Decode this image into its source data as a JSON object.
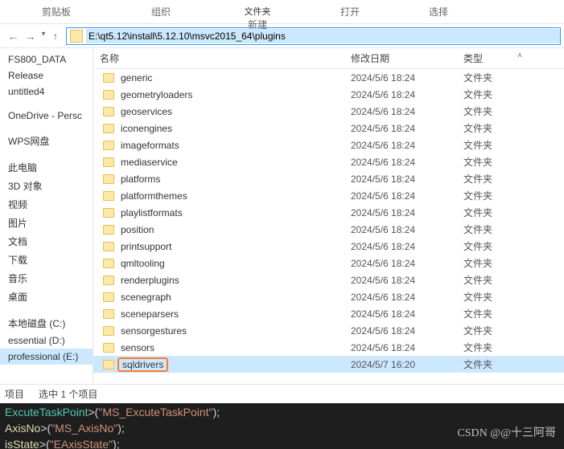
{
  "ribbon": {
    "clip_label": "剪贴板",
    "org_label": "组织",
    "file_top": "文件夹",
    "new_label": "新建",
    "open_label": "打开",
    "select_label": "选择"
  },
  "address": {
    "path": "E:\\qt5.12\\install\\5.12.10\\msvc2015_64\\plugins"
  },
  "tree": {
    "items": [
      "FS800_DATA",
      "Release",
      "untitled4",
      "OneDrive - Persc",
      "WPS网盘",
      "此电脑",
      "3D 对象",
      "视频",
      "图片",
      "文档",
      "下载",
      "音乐",
      "桌面",
      "本地磁盘 (C:)",
      "essential (D:)",
      "professional (E:)"
    ],
    "selected_index": 15
  },
  "columns": {
    "name": "名称",
    "date": "修改日期",
    "type": "类型"
  },
  "rows": [
    {
      "name": "generic",
      "date": "2024/5/6 18:24",
      "type": "文件夹"
    },
    {
      "name": "geometryloaders",
      "date": "2024/5/6 18:24",
      "type": "文件夹"
    },
    {
      "name": "geoservices",
      "date": "2024/5/6 18:24",
      "type": "文件夹"
    },
    {
      "name": "iconengines",
      "date": "2024/5/6 18:24",
      "type": "文件夹"
    },
    {
      "name": "imageformats",
      "date": "2024/5/6 18:24",
      "type": "文件夹"
    },
    {
      "name": "mediaservice",
      "date": "2024/5/6 18:24",
      "type": "文件夹"
    },
    {
      "name": "platforms",
      "date": "2024/5/6 18:24",
      "type": "文件夹"
    },
    {
      "name": "platformthemes",
      "date": "2024/5/6 18:24",
      "type": "文件夹"
    },
    {
      "name": "playlistformats",
      "date": "2024/5/6 18:24",
      "type": "文件夹"
    },
    {
      "name": "position",
      "date": "2024/5/6 18:24",
      "type": "文件夹"
    },
    {
      "name": "printsupport",
      "date": "2024/5/6 18:24",
      "type": "文件夹"
    },
    {
      "name": "qmltooling",
      "date": "2024/5/6 18:24",
      "type": "文件夹"
    },
    {
      "name": "renderplugins",
      "date": "2024/5/6 18:24",
      "type": "文件夹"
    },
    {
      "name": "scenegraph",
      "date": "2024/5/6 18:24",
      "type": "文件夹"
    },
    {
      "name": "sceneparsers",
      "date": "2024/5/6 18:24",
      "type": "文件夹"
    },
    {
      "name": "sensorgestures",
      "date": "2024/5/6 18:24",
      "type": "文件夹"
    },
    {
      "name": "sensors",
      "date": "2024/5/6 18:24",
      "type": "文件夹"
    },
    {
      "name": "sqldrivers",
      "date": "2024/5/7 16:20",
      "type": "文件夹",
      "selected": true,
      "highlight": true
    }
  ],
  "status": {
    "left": "项目",
    "right": "选中 1 个项目"
  },
  "code": {
    "l1a": "ExcuteTaskPoint",
    "l1b": ">(",
    "l1c": "\"MS_ExcuteTaskPoint\"",
    "l1d": ");",
    "l2a": "AxisNo",
    "l2b": ">(",
    "l2c": "\"MS_AxisNo\"",
    "l2d": ");",
    "l3a": "isState",
    "l3b": ">(",
    "l3c": "\"EAxisState\"",
    "l3d": ");"
  },
  "watermark": "CSDN @@十三阿哥"
}
